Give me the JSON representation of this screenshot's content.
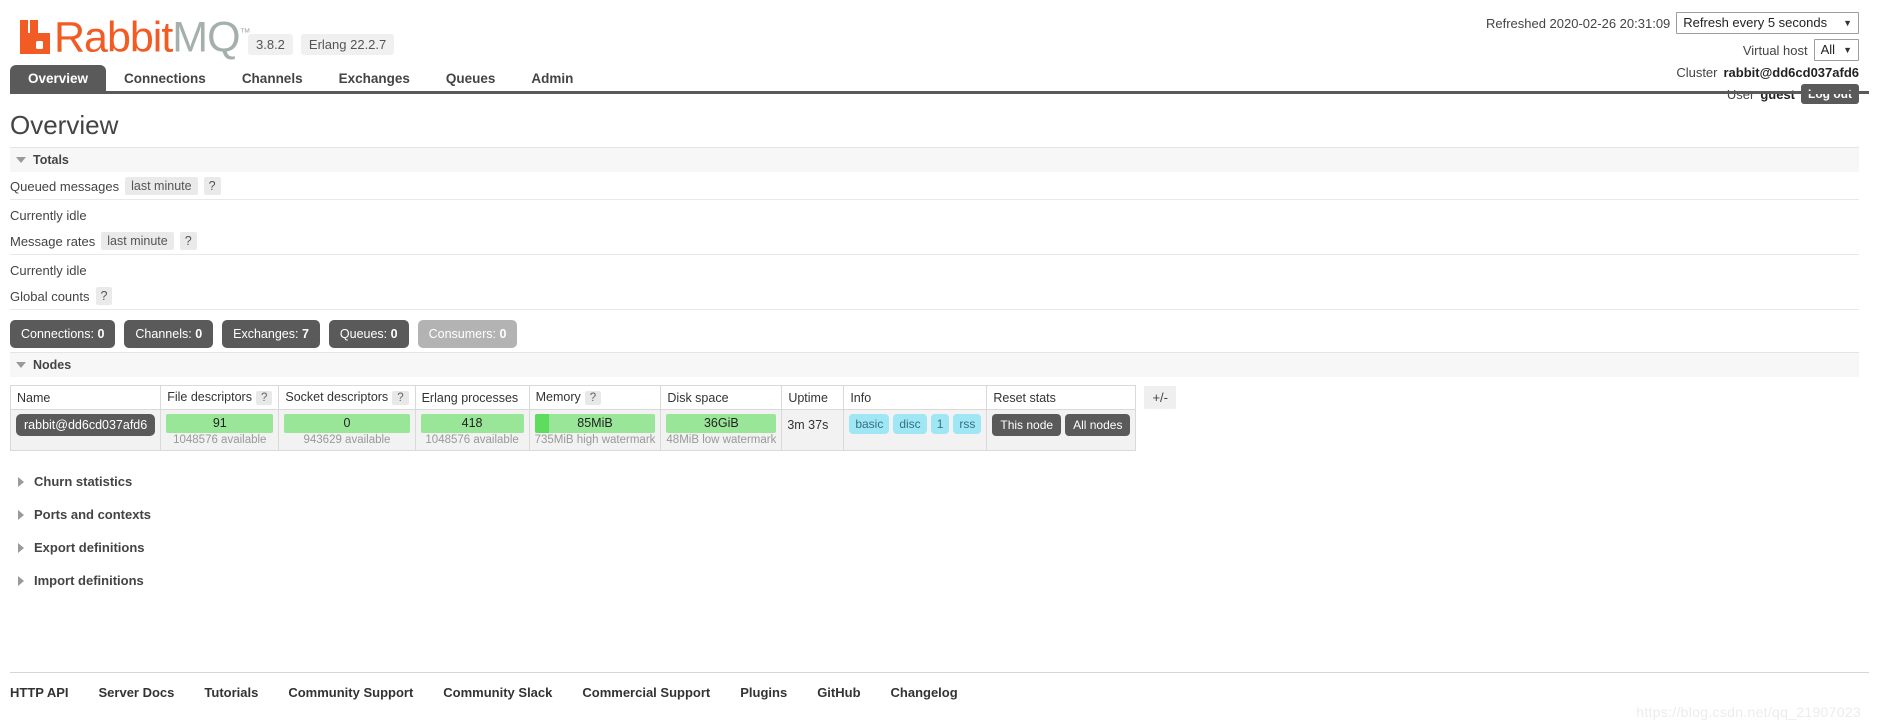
{
  "brand": {
    "name_part1": "Rabbit",
    "name_part2": "MQ",
    "trademark": "™",
    "version": "3.8.2",
    "erlang": "Erlang 22.2.7"
  },
  "header": {
    "refreshed_label": "Refreshed 2020-02-26 20:31:09",
    "refresh_select": "Refresh every 5 seconds",
    "vhost_label": "Virtual host",
    "vhost_select": "All",
    "cluster_label": "Cluster",
    "cluster_value": "rabbit@dd6cd037afd6",
    "user_label": "User",
    "user_value": "guest",
    "logout_label": "Log out"
  },
  "tabs": [
    {
      "label": "Overview",
      "active": true
    },
    {
      "label": "Connections",
      "active": false
    },
    {
      "label": "Channels",
      "active": false
    },
    {
      "label": "Exchanges",
      "active": false
    },
    {
      "label": "Queues",
      "active": false
    },
    {
      "label": "Admin",
      "active": false
    }
  ],
  "page_title": "Overview",
  "totals": {
    "section_label": "Totals",
    "queued_messages_label": "Queued messages",
    "queued_messages_chip": "last minute",
    "queued_messages_help": "?",
    "queued_messages_status": "Currently idle",
    "message_rates_label": "Message rates",
    "message_rates_chip": "last minute",
    "message_rates_help": "?",
    "message_rates_status": "Currently idle",
    "global_counts_label": "Global counts",
    "global_counts_help": "?"
  },
  "counts": [
    {
      "label": "Connections:",
      "value": "0",
      "muted": false
    },
    {
      "label": "Channels:",
      "value": "0",
      "muted": false
    },
    {
      "label": "Exchanges:",
      "value": "7",
      "muted": false
    },
    {
      "label": "Queues:",
      "value": "0",
      "muted": false
    },
    {
      "label": "Consumers:",
      "value": "0",
      "muted": true
    }
  ],
  "nodes": {
    "section_label": "Nodes",
    "columns": [
      {
        "label": "Name",
        "help": ""
      },
      {
        "label": "File descriptors",
        "help": "?"
      },
      {
        "label": "Socket descriptors",
        "help": "?"
      },
      {
        "label": "Erlang processes",
        "help": ""
      },
      {
        "label": "Memory",
        "help": "?"
      },
      {
        "label": "Disk space",
        "help": ""
      },
      {
        "label": "Uptime",
        "help": ""
      },
      {
        "label": "Info",
        "help": ""
      },
      {
        "label": "Reset stats",
        "help": ""
      }
    ],
    "plusminus": "+/-",
    "row": {
      "name": "rabbit@dd6cd037afd6",
      "file_descriptors": "91",
      "file_descriptors_sub": "1048576 available",
      "socket_descriptors": "0",
      "socket_descriptors_sub": "943629 available",
      "erlang_processes": "418",
      "erlang_processes_sub": "1048576 available",
      "memory": "85MiB",
      "memory_sub": "735MiB high watermark",
      "memory_fill_pct": "12%",
      "disk_space": "36GiB",
      "disk_space_sub": "48MiB low watermark",
      "disk_fill_pct": "0%",
      "uptime": "3m 37s",
      "info_badges": [
        "basic",
        "disc",
        "1",
        "rss"
      ],
      "reset_buttons": [
        "This node",
        "All nodes"
      ]
    }
  },
  "collapsed_sections": [
    {
      "label": "Churn statistics"
    },
    {
      "label": "Ports and contexts"
    },
    {
      "label": "Export definitions"
    },
    {
      "label": "Import definitions"
    }
  ],
  "footer_links": [
    "HTTP API",
    "Server Docs",
    "Tutorials",
    "Community Support",
    "Community Slack",
    "Commercial Support",
    "Plugins",
    "GitHub",
    "Changelog"
  ],
  "watermark": "https://blog.csdn.net/qq_21907023",
  "colors": {
    "brand_orange": "#f25c24",
    "brand_grey": "#a5b0ad",
    "dark_grey": "#5a5a5a",
    "bar_green_light": "#99e699",
    "bar_green_dark": "#5edc5e",
    "info_cyan": "#9fe7f5"
  }
}
